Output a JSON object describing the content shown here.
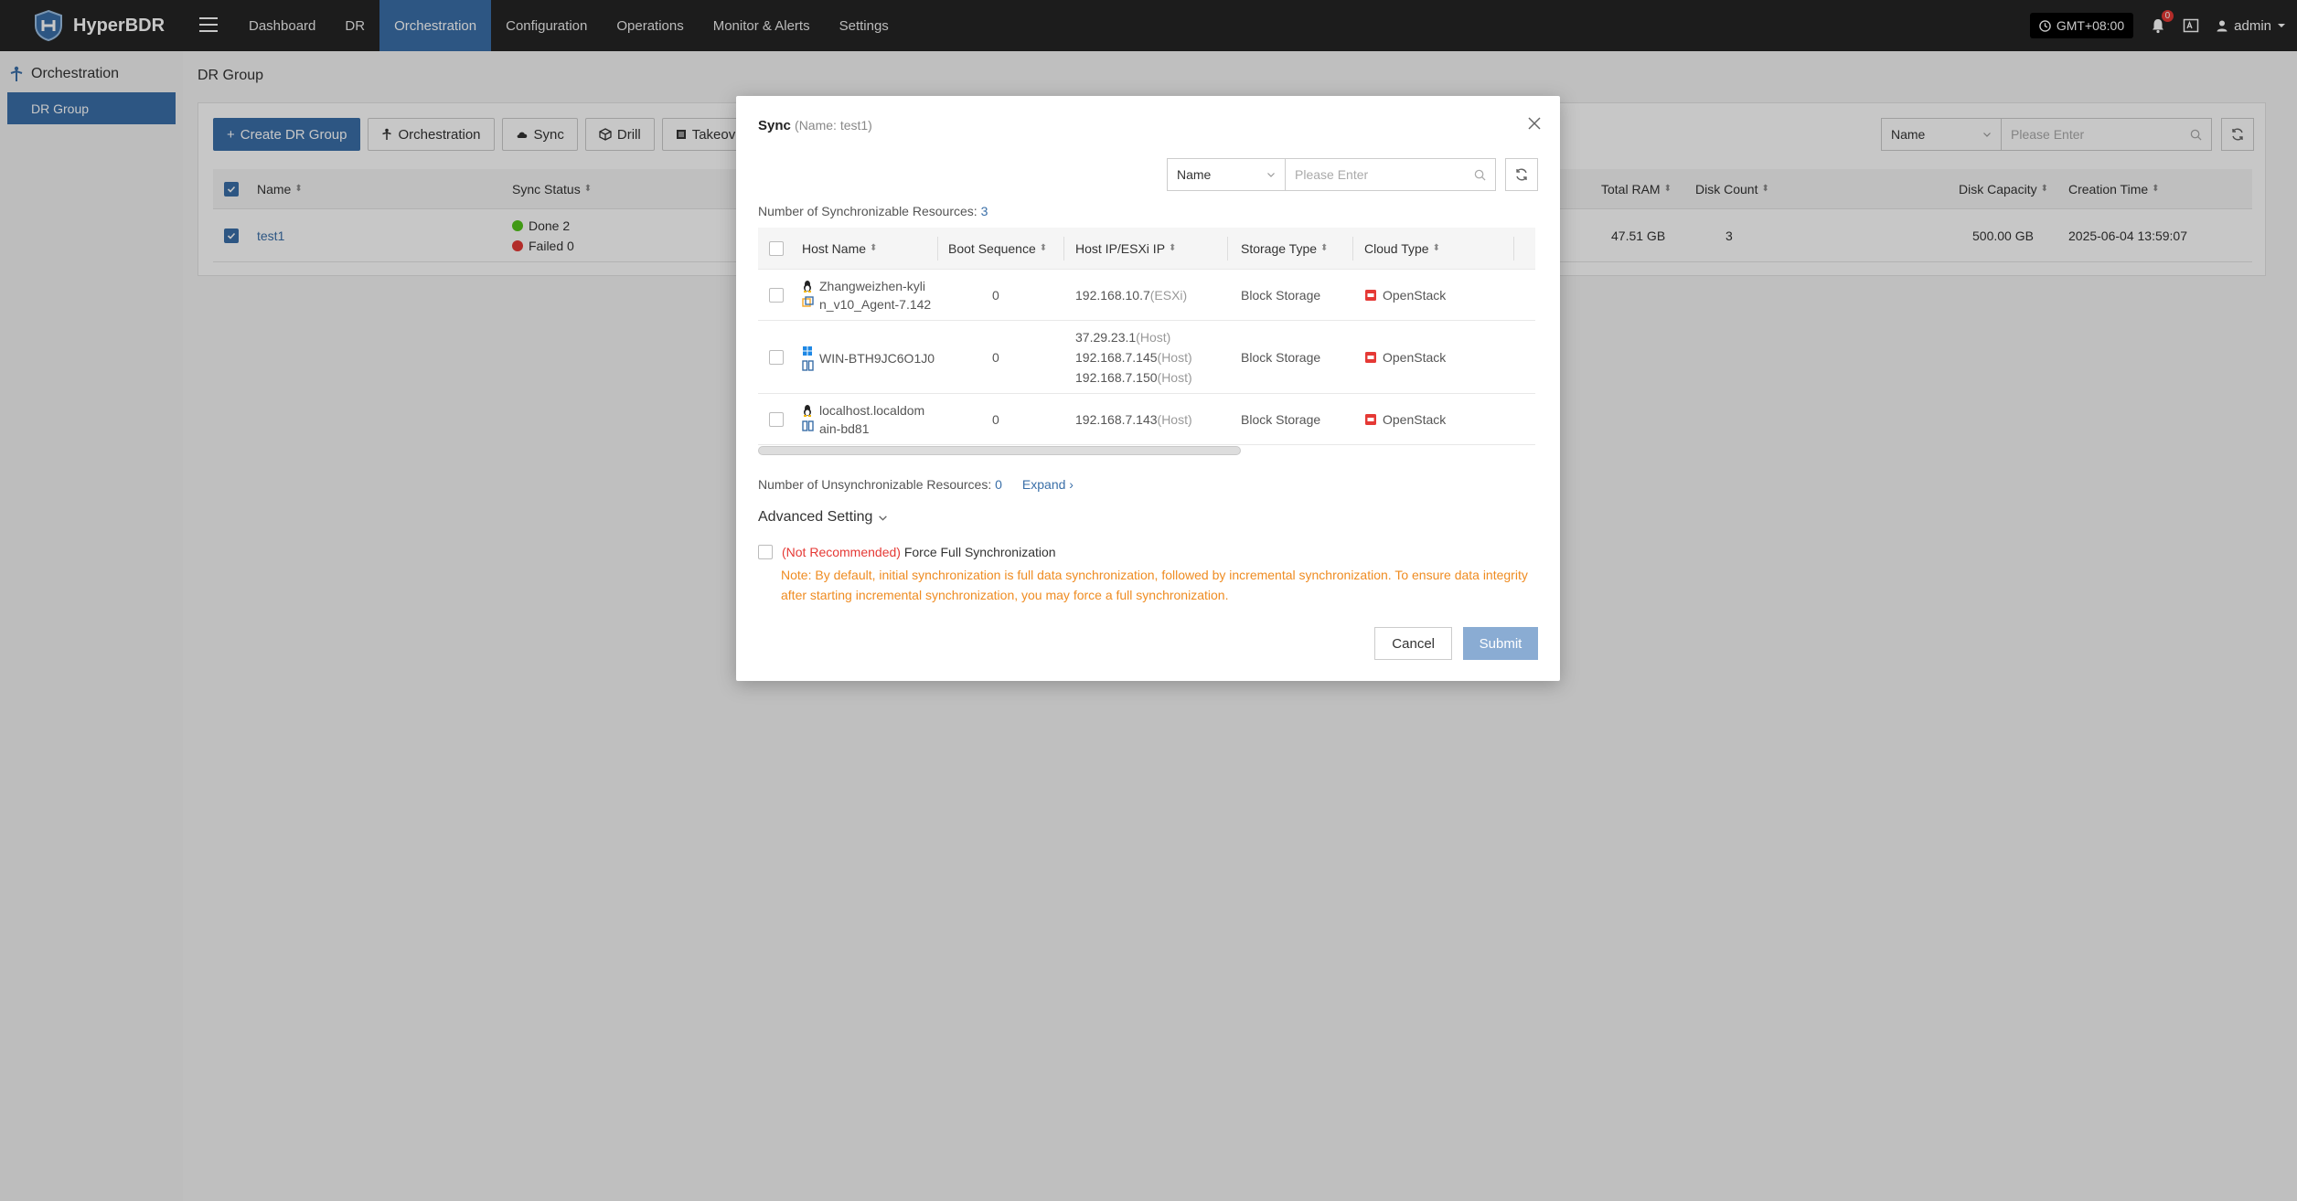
{
  "app": {
    "brand": "HyperBDR"
  },
  "nav": {
    "items": [
      "Dashboard",
      "DR",
      "Orchestration",
      "Configuration",
      "Operations",
      "Monitor & Alerts",
      "Settings"
    ],
    "active_index": 2
  },
  "topright": {
    "timezone": "GMT+08:00",
    "notifications": "0",
    "user": "admin"
  },
  "sidebar": {
    "section": "Orchestration",
    "item": "DR Group"
  },
  "main": {
    "breadcrumb": "DR Group",
    "toolbar": {
      "create": "Create DR Group",
      "orchestration": "Orchestration",
      "sync": "Sync",
      "drill": "Drill",
      "takeover": "Takeover"
    },
    "search": {
      "field": "Name",
      "placeholder": "Please Enter"
    },
    "table": {
      "headers": {
        "name": "Name",
        "sync_status": "Sync Status",
        "total_ram": "Total RAM",
        "disk_count": "Disk Count",
        "disk_capacity": "Disk Capacity",
        "creation_time": "Creation Time"
      },
      "row": {
        "name": "test1",
        "done": "Done 2",
        "failed": "Failed 0",
        "total_ram": "47.51 GB",
        "disk_count": "3",
        "disk_capacity": "500.00 GB",
        "creation_time": "2025-06-04 13:59:07"
      }
    }
  },
  "modal": {
    "title": "Sync",
    "subtitle": "(Name: test1)",
    "search": {
      "field": "Name",
      "placeholder": "Please Enter"
    },
    "sync_count_label": "Number of Synchronizable Resources:",
    "sync_count": "3",
    "headers": {
      "host_name": "Host Name",
      "boot_sequence": "Boot Sequence",
      "host_ip": "Host IP/ESXi IP",
      "storage_type": "Storage Type",
      "cloud_type": "Cloud Type"
    },
    "rows": [
      {
        "host_line1": "Zhangweizhen-kyli",
        "host_line2": "n_v10_Agent-7.142",
        "boot": "0",
        "ips": [
          {
            "ip": "192.168.10.7",
            "tag": "(ESXi)"
          }
        ],
        "storage": "Block Storage",
        "cloud": "OpenStack"
      },
      {
        "host_line1": "WIN-BTH9JC6O1J0",
        "host_line2": "",
        "boot": "0",
        "ips": [
          {
            "ip": "37.29.23.1",
            "tag": "(Host)"
          },
          {
            "ip": "192.168.7.145",
            "tag": "(Host)"
          },
          {
            "ip": "192.168.7.150",
            "tag": "(Host)"
          }
        ],
        "storage": "Block Storage",
        "cloud": "OpenStack"
      },
      {
        "host_line1": "localhost.localdom",
        "host_line2": "ain-bd81",
        "boot": "0",
        "ips": [
          {
            "ip": "192.168.7.143",
            "tag": "(Host)"
          }
        ],
        "storage": "Block Storage",
        "cloud": "OpenStack"
      }
    ],
    "unsync_label": "Number of Unsynchronizable Resources:",
    "unsync_count": "0",
    "expand": "Expand",
    "advanced": "Advanced Setting",
    "force_warn": "(Not Recommended)",
    "force_label": "Force Full Synchronization",
    "note": "Note: By default, initial synchronization is full data synchronization, followed by incremental synchronization. To ensure data integrity after starting incremental synchronization, you may force a full synchronization.",
    "cancel": "Cancel",
    "submit": "Submit"
  },
  "colors": {
    "accent": "#3a6fa8",
    "topbar": "#252525",
    "warning_text": "#ef8c22",
    "danger": "#e53935",
    "success": "#52c41a"
  }
}
